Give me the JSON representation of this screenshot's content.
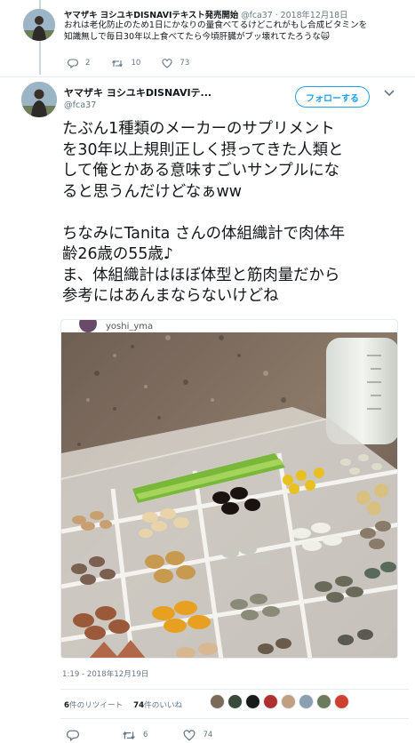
{
  "reply_tweet": {
    "author_name": "ヤマザキ ヨシユキDISNAVIテキスト発売開始",
    "handle": "@fca37",
    "separator": "·",
    "date": "2018年12月18日",
    "text_lines": [
      "おれは老化防止のため1日にかなりの量食べてるけどこれがもし合成ビタミンを",
      "知識無しで毎日30年以上食べてたら今頃肝臓がブッ壊れてたろうな"
    ],
    "emoji": "🙀",
    "replies": "2",
    "retweets": "10",
    "likes": "73"
  },
  "main_tweet": {
    "author_name": "ヤマザキ ヨシユキDISNAVIテ...",
    "handle": "@fca37",
    "follow_label": "フォローする",
    "text_lines": [
      "たぶん1種類のメーカーのサプリメント",
      "を30年以上規則正しく摂ってきた人類と",
      "して俺とかある意味すごいサンプルにな",
      "ると思うんだけどなぁww",
      "",
      "ちなみにTanita さんの体組織計で肉体年",
      "齢26歳の55歳♪",
      "ま、体組織計はほぼ体型と筋肉量だから",
      "参考にはあんまならないけどね"
    ],
    "photo_caption": "yoshi_yma",
    "timestamp": "1:19 - 2018年12月19日",
    "retweet_count": "6",
    "retweet_label": "件のリツイート",
    "like_count": "74",
    "like_label": "件のいいね",
    "replies": "",
    "retweets": "6",
    "likes": "74",
    "liker_colors": [
      "#7a6a58",
      "#3a4a3a",
      "#1a1a1a",
      "#b03030",
      "#c0a080",
      "#8aa0b0",
      "#6b7b5b",
      "#d04030"
    ]
  },
  "colors": {
    "accent": "#1da1f2",
    "text": "#14171a",
    "secondary": "#657786",
    "border": "#e6ecf0"
  },
  "icons": {
    "reply": "reply-icon",
    "retweet": "retweet-icon",
    "like": "heart-icon",
    "dm": "envelope-icon",
    "more": "chevron-down-icon"
  }
}
